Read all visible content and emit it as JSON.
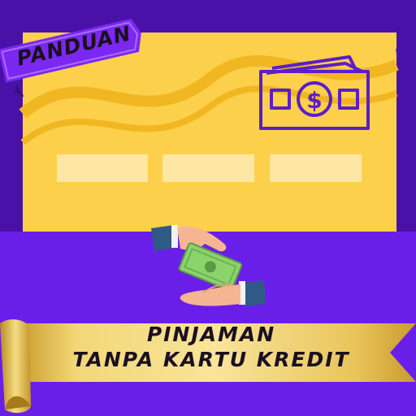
{
  "badge": {
    "label": "PANDUAN"
  },
  "banner": {
    "line1": "PINJAMAN",
    "line2": "TANPA KARTU KREDIT"
  },
  "colors": {
    "background_top": "#4a11a8",
    "background_bottom": "#6a1fe8",
    "card": "#fcd04a",
    "card_wave": "#f1b722",
    "card_field": "#fee7a2",
    "banner_gold": "#f0d06a",
    "money_green": "#8bd36b",
    "skin": "#f6b592",
    "sleeve": "#2f5a86",
    "outline": "#5b1ec9"
  },
  "icons": [
    "banknote-icon",
    "hands-money-icon"
  ]
}
